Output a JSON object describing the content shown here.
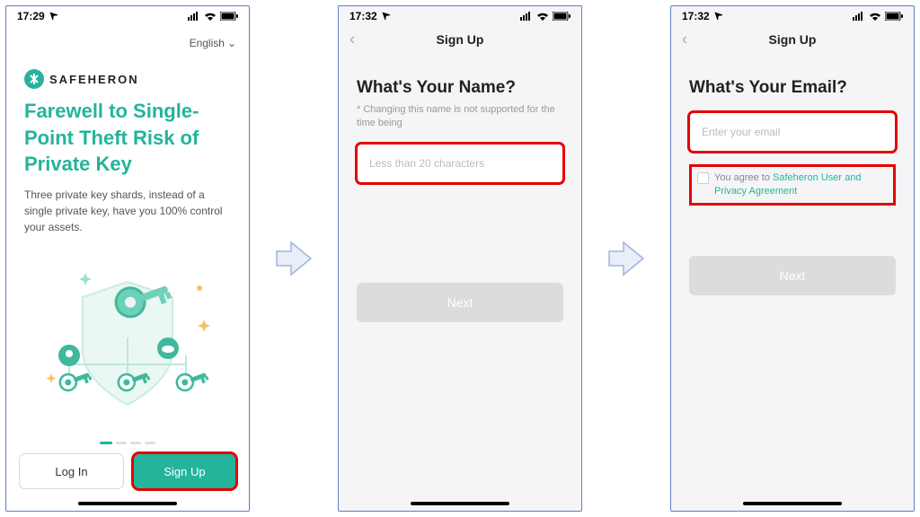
{
  "statusbar": {
    "time1": "17:29",
    "time2": "17:32",
    "time3": "17:32"
  },
  "screen1": {
    "language": "English",
    "brand": "SAFEHERON",
    "headline": "Farewell to Single-Point Theft Risk of Private Key",
    "subhead": "Three private key shards, instead of a single private key, have you 100% control your assets.",
    "login_label": "Log In",
    "signup_label": "Sign Up"
  },
  "screen2": {
    "nav_title": "Sign Up",
    "heading": "What's Your Name?",
    "hint": "* Changing this name is not supported for the time being",
    "placeholder": "Less than 20 characters",
    "next_label": "Next"
  },
  "screen3": {
    "nav_title": "Sign Up",
    "heading": "What's Your Email?",
    "placeholder": "Enter your email",
    "agree_prefix": "You agree to ",
    "agree_link": "Safeheron User and Privacy Agreement",
    "next_label": "Next"
  }
}
